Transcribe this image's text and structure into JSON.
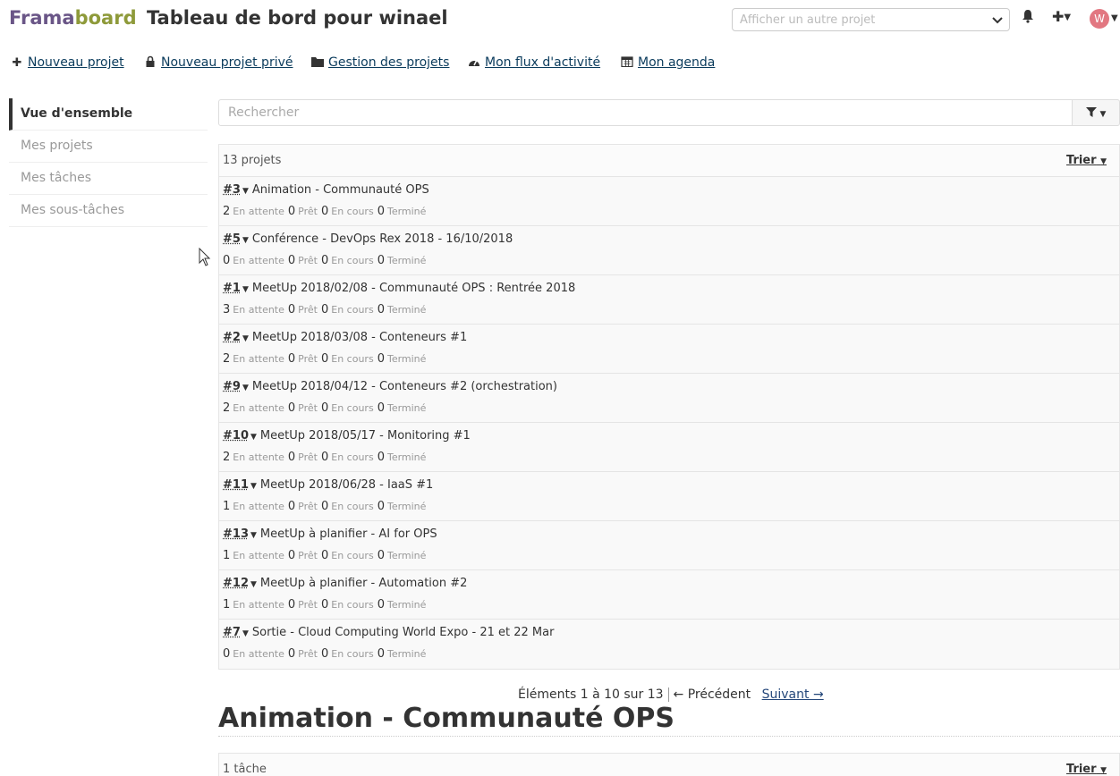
{
  "header": {
    "brand_frama": "Frama",
    "brand_board": "board",
    "title": "Tableau de bord pour winael",
    "project_select_placeholder": "Afficher un autre projet",
    "avatar_letter": "W"
  },
  "actions": {
    "new_project": "Nouveau projet",
    "new_private_project": "Nouveau projet privé",
    "manage_projects": "Gestion des projets",
    "activity_stream": "Mon flux d'activité",
    "calendar": "Mon agenda"
  },
  "sidebar": {
    "items": [
      {
        "label": "Vue d'ensemble"
      },
      {
        "label": "Mes projets"
      },
      {
        "label": "Mes tâches"
      },
      {
        "label": "Mes sous-tâches"
      }
    ]
  },
  "search": {
    "placeholder": "Rechercher"
  },
  "projects": {
    "count_label": "13 projets",
    "sort_label": "Trier",
    "status_labels": {
      "waiting": "En attente",
      "ready": "Prêt",
      "in_progress": "En cours",
      "done": "Terminé"
    },
    "rows": [
      {
        "id": "#3",
        "name": "Animation - Communauté OPS",
        "waiting": "2",
        "ready": "0",
        "in_progress": "0",
        "done": "0"
      },
      {
        "id": "#5",
        "name": "Conférence - DevOps Rex 2018 - 16/10/2018",
        "waiting": "0",
        "ready": "0",
        "in_progress": "0",
        "done": "0"
      },
      {
        "id": "#1",
        "name": "MeetUp 2018/02/08 - Communauté OPS : Rentrée 2018",
        "waiting": "3",
        "ready": "0",
        "in_progress": "0",
        "done": "0"
      },
      {
        "id": "#2",
        "name": "MeetUp 2018/03/08 - Conteneurs #1",
        "waiting": "2",
        "ready": "0",
        "in_progress": "0",
        "done": "0"
      },
      {
        "id": "#9",
        "name": "MeetUp 2018/04/12 - Conteneurs #2 (orchestration)",
        "waiting": "2",
        "ready": "0",
        "in_progress": "0",
        "done": "0"
      },
      {
        "id": "#10",
        "name": "MeetUp 2018/05/17 - Monitoring #1",
        "waiting": "2",
        "ready": "0",
        "in_progress": "0",
        "done": "0"
      },
      {
        "id": "#11",
        "name": "MeetUp 2018/06/28 - IaaS #1",
        "waiting": "1",
        "ready": "0",
        "in_progress": "0",
        "done": "0"
      },
      {
        "id": "#13",
        "name": "MeetUp à planifier - AI for OPS",
        "waiting": "1",
        "ready": "0",
        "in_progress": "0",
        "done": "0"
      },
      {
        "id": "#12",
        "name": "MeetUp à planifier - Automation #2",
        "waiting": "1",
        "ready": "0",
        "in_progress": "0",
        "done": "0"
      },
      {
        "id": "#7",
        "name": "Sortie - Cloud Computing World Expo - 21 et 22 Mar",
        "waiting": "0",
        "ready": "0",
        "in_progress": "0",
        "done": "0"
      }
    ]
  },
  "pager": {
    "summary": "Éléments 1 à 10 sur 13",
    "previous": "← Précédent",
    "next": "Suivant →"
  },
  "section": {
    "title": "Animation - Communauté OPS",
    "count_label": "1 tâche",
    "sort_label": "Trier"
  },
  "icons": {
    "bell": "bell-icon",
    "plus": "plus-icon",
    "lock": "lock-icon",
    "folder": "folder-icon",
    "dashboard": "dashboard-icon",
    "calendar": "calendar-icon",
    "filter": "filter-icon"
  }
}
